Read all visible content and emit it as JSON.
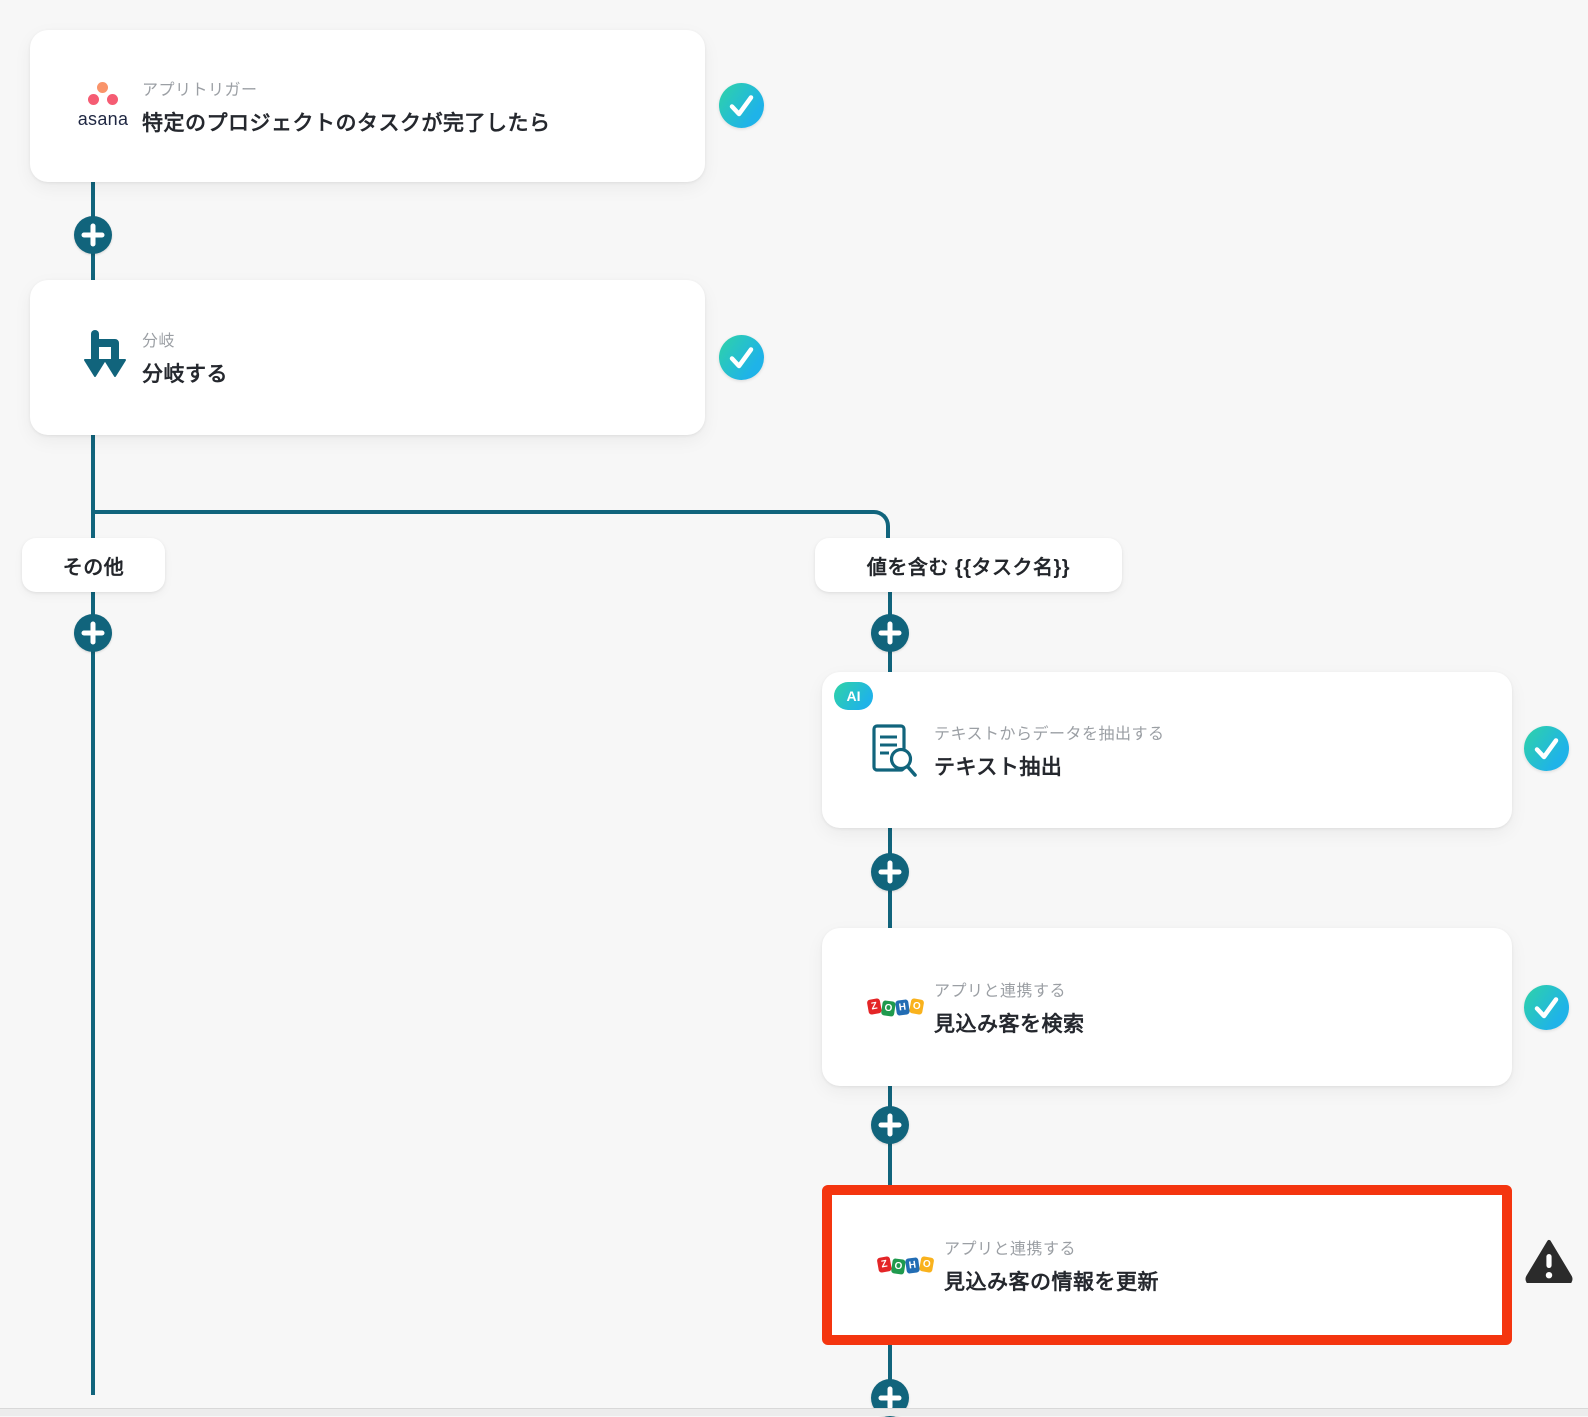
{
  "colors": {
    "background": "#f7f7f7",
    "connector": "#11647c",
    "success_badge_gradient": [
      "#2fd3a6",
      "#1fb3e8"
    ],
    "error_highlight": "#f4350f",
    "warning_icon": "#2b2b2b",
    "zoho_letter_colors": [
      "#e42527",
      "#1f9a4e",
      "#226db4",
      "#f9b21d"
    ]
  },
  "nodes": {
    "trigger": {
      "app": "asana",
      "app_wordmark": "asana",
      "type_label": "アプリトリガー",
      "title": "特定のプロジェクトのタスクが完了したら",
      "status": "completed"
    },
    "branch": {
      "type_label": "分岐",
      "title": "分岐する",
      "status": "completed"
    },
    "text_extract": {
      "badge": "AI",
      "type_label": "テキストからデータを抽出する",
      "title": "テキスト抽出",
      "status": "completed"
    },
    "zoho_search": {
      "app": "ZOHO",
      "type_label": "アプリと連携する",
      "title": "見込み客を検索",
      "status": "completed"
    },
    "zoho_update": {
      "app": "ZOHO",
      "type_label": "アプリと連携する",
      "title": "見込み客の情報を更新",
      "status": "error",
      "selected": true
    }
  },
  "branch_labels": {
    "left": "その他",
    "right": "値を含む {{タスク名}}"
  },
  "zoho": {
    "letters": [
      {
        "ch": "Z"
      },
      {
        "ch": "O"
      },
      {
        "ch": "H"
      },
      {
        "ch": "O"
      }
    ]
  },
  "icons": {
    "plus": "add-step",
    "check": "step-completed",
    "warning": "step-error",
    "branch": "branch-split",
    "document_search": "extract-text-from-document"
  }
}
